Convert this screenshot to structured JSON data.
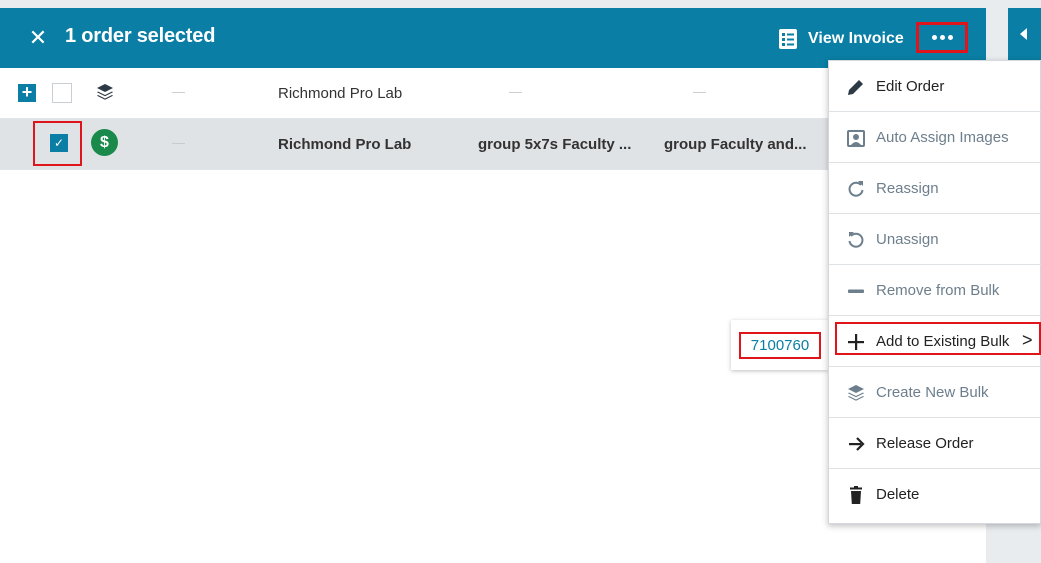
{
  "header": {
    "close_symbol": "✕",
    "title": "1 order selected",
    "view_invoice_label": "View Invoice",
    "more_icon": "more-horizontal-icon"
  },
  "rows": [
    {
      "expand_symbol": "+",
      "selected": false,
      "type_icon": "layers-icon",
      "col1": "—",
      "lab": "Richmond Pro Lab",
      "col3": "—",
      "col4": "—"
    },
    {
      "expand_symbol": "",
      "selected": true,
      "check_symbol": "✓",
      "type_icon": "dollar-icon",
      "dollar_symbol": "$",
      "col1": "—",
      "lab": "Richmond Pro Lab",
      "col3": "group 5x7s Faculty ...",
      "col4": "group Faculty and..."
    }
  ],
  "bulk_popover": {
    "value": "7100760"
  },
  "menu": {
    "items": [
      {
        "label": "Edit Order",
        "icon": "pencil-icon",
        "enabled": true
      },
      {
        "label": "Auto Assign Images",
        "icon": "image-portrait-icon",
        "enabled": false
      },
      {
        "label": "Reassign",
        "icon": "redo-icon",
        "enabled": false
      },
      {
        "label": "Unassign",
        "icon": "undo-icon",
        "enabled": false
      },
      {
        "label": "Remove from Bulk",
        "icon": "minus-icon",
        "enabled": false
      },
      {
        "label": "Add to Existing Bulk",
        "icon": "plus-icon",
        "enabled": true,
        "submenu_chevron": ">"
      },
      {
        "label": "Create New Bulk",
        "icon": "layers-icon",
        "enabled": false
      },
      {
        "label": "Release Order",
        "icon": "arrow-right-icon",
        "enabled": true
      },
      {
        "label": "Delete",
        "icon": "trash-icon",
        "enabled": true
      }
    ]
  },
  "colors": {
    "primary": "#0a7ea4",
    "highlight": "#e0141b",
    "success": "#1a8a4c",
    "disabled_text": "#6d7e8c"
  }
}
